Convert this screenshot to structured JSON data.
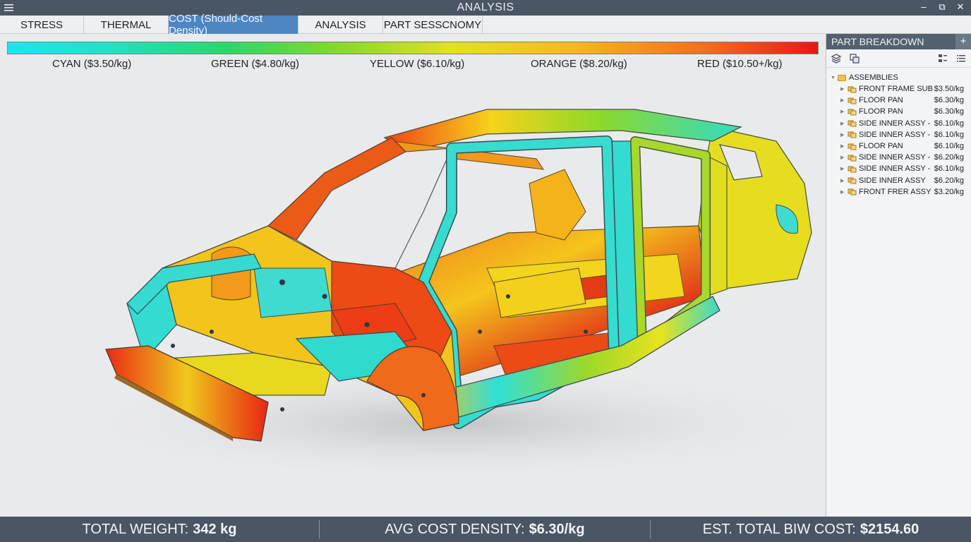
{
  "window": {
    "title": "ANALYSIS"
  },
  "tabs": [
    {
      "label": "STRESS",
      "active": false
    },
    {
      "label": "THERMAL",
      "active": false
    },
    {
      "label": "COST (Should-Cost Density)",
      "active": true
    },
    {
      "label": "ANALYSIS",
      "active": false
    },
    {
      "label": "PART SESSCNOMY",
      "active": false
    }
  ],
  "legend": {
    "labels": [
      "CYAN ($3.50/kg)",
      "GREEN ($4.80/kg)",
      "YELLOW ($6.10/kg)",
      "ORANGE ($8.20/kg)",
      "RED ($10.50+/kg)"
    ],
    "colors": [
      "#19e6ef",
      "#2bd86a",
      "#e5e21b",
      "#f8a11a",
      "#ee1414"
    ]
  },
  "panel": {
    "title": "PART BREAKDOWN",
    "add_label": "+",
    "root_label": "ASSEMBLIES",
    "items": [
      {
        "name": "FRONT FRAME SUB-ASSY",
        "cost": "$3.50/kg"
      },
      {
        "name": "FLOOR PAN",
        "cost": "$6.30/kg"
      },
      {
        "name": "FLOOR PAN",
        "cost": "$6.30/kg"
      },
      {
        "name": "SIDE INNER ASSY - LH",
        "cost": "$6.10/kg"
      },
      {
        "name": "SIDE INNER ASSY - LH",
        "cost": "$6.10/kg"
      },
      {
        "name": "FLOOR PAN",
        "cost": "$6.10/kg"
      },
      {
        "name": "SIDE INNER ASSY - LH",
        "cost": "$6.20/kg"
      },
      {
        "name": "SIDE INNER ASSY - LH",
        "cost": "$6.10/kg"
      },
      {
        "name": "SIDE INNER ASSY",
        "cost": "$6.20/kg"
      },
      {
        "name": "FRONT FRER ASSY",
        "cost": "$3.20/kg"
      }
    ]
  },
  "status": {
    "weight_label": "TOTAL WEIGHT:",
    "weight_value": "342 kg",
    "density_label": "AVG COST DENSITY:",
    "density_value": "$6.30/kg",
    "cost_label": "EST. TOTAL BIW COST:",
    "cost_value": "$2154.60"
  },
  "colors": {
    "chrome": "#4a5663",
    "accent": "#4e86c2"
  }
}
